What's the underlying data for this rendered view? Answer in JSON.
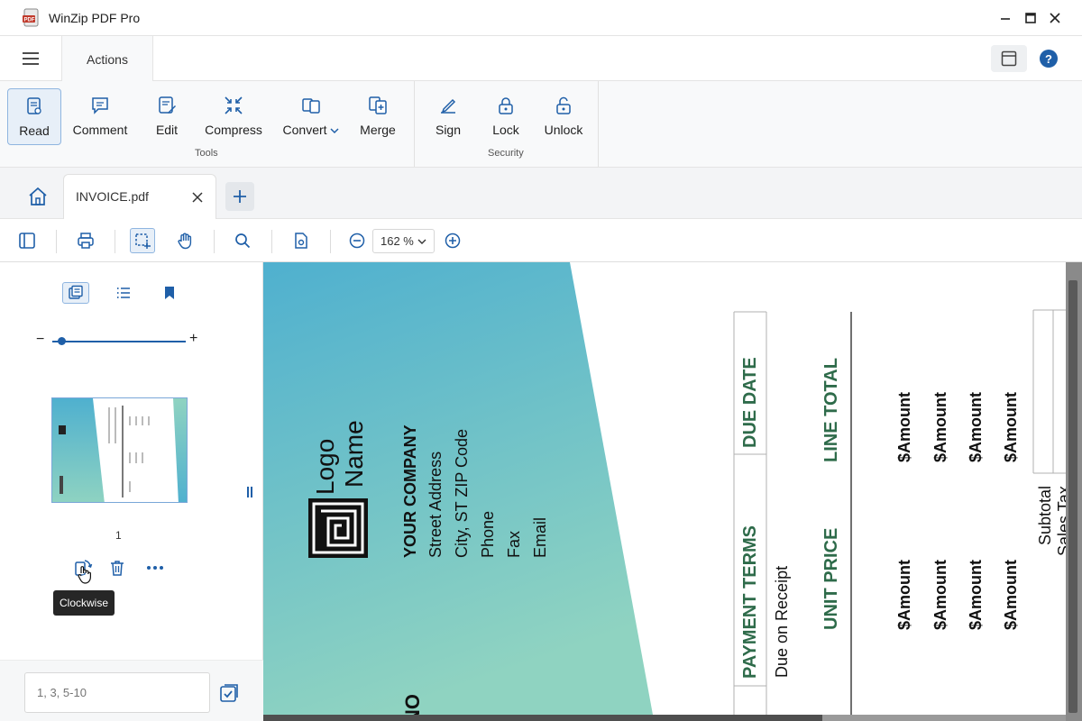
{
  "window": {
    "title": "WinZip PDF Pro"
  },
  "menu": {
    "tab": "Actions"
  },
  "ribbon": {
    "tools": [
      {
        "label": "Read"
      },
      {
        "label": "Comment"
      },
      {
        "label": "Edit"
      },
      {
        "label": "Compress"
      },
      {
        "label": "Convert"
      },
      {
        "label": "Merge"
      }
    ],
    "tools_group": "Tools",
    "security": [
      {
        "label": "Sign"
      },
      {
        "label": "Lock"
      },
      {
        "label": "Unlock"
      }
    ],
    "security_group": "Security"
  },
  "tabs": {
    "document": "INVOICE.pdf"
  },
  "toolbar": {
    "zoom": "162 %"
  },
  "sidebar": {
    "page_number": "1",
    "tooltip": "Clockwise",
    "page_range_placeholder": "1, 3, 5-10",
    "thumbnail_size": 0.05
  },
  "invoice": {
    "logo_line1": "Logo",
    "logo_line2": "Name",
    "company": "YOUR COMPANY",
    "address": [
      "Street Address",
      "City, ST ZIP Code",
      "Phone",
      "Fax",
      "Email"
    ],
    "due_date_header": "DUE DATE",
    "payment_terms_header": "PAYMENT TERMS",
    "payment_terms_value": "Due on Receipt",
    "line_total_header": "LINE TOTAL",
    "unit_price_header": "UNIT PRICE",
    "amounts_total": [
      "$Amount",
      "$Amount",
      "$Amount",
      "$Amount"
    ],
    "amounts_unit": [
      "$Amount",
      "$Amount",
      "$Amount",
      "$Amount"
    ],
    "subtotal": "Subtotal",
    "sales_tax": "Sales Tax",
    "cut_text": "NO"
  },
  "colors": {
    "accent": "#1f5fa8",
    "heading_green": "#2e6b4a",
    "gradient_top": "#4fb0cf",
    "gradient_bottom": "#8fd3c1"
  }
}
